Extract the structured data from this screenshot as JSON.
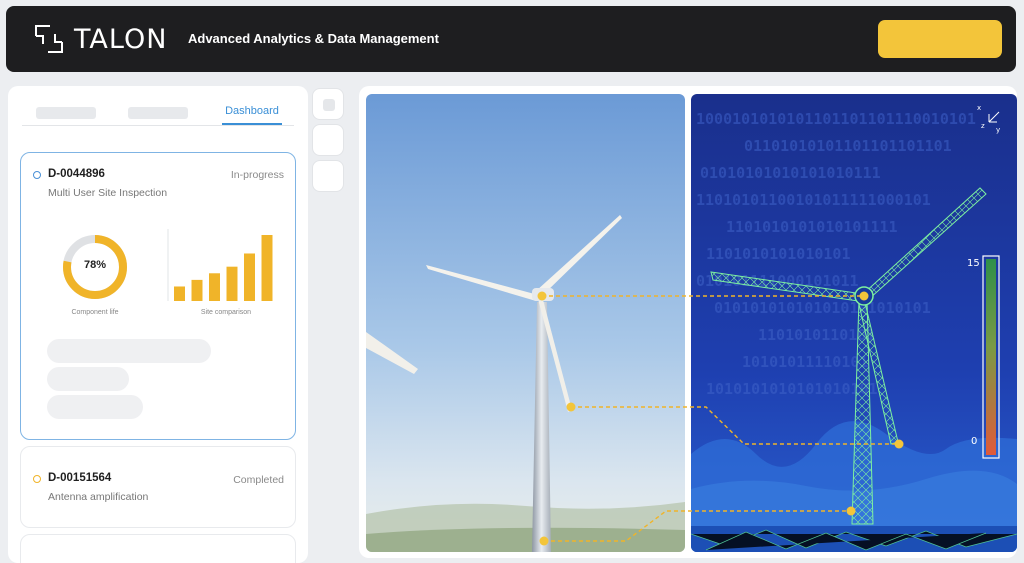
{
  "header": {
    "brand": "TALON",
    "tagline": "Advanced Analytics & Data Management",
    "cta_color": "#f3c53a"
  },
  "tabs": {
    "active_label": "Dashboard"
  },
  "cards": [
    {
      "id": "D-0044896",
      "subtitle": "Multi User Site Inspection",
      "status": "In-progress",
      "dot_color": "#4a90d6"
    },
    {
      "id": "D-00151564",
      "subtitle": "Antenna amplification",
      "status": "Completed",
      "dot_color": "#f0b429"
    }
  ],
  "widgets": {
    "component_life": {
      "value": 0.78,
      "value_text": "78%",
      "label": "Component life"
    },
    "site_comparison": {
      "label": "Site comparison",
      "values": [
        0.22,
        0.32,
        0.42,
        0.52,
        0.72,
        1.0
      ]
    }
  },
  "visualization": {
    "axis_labels": [
      "x",
      "z",
      "y"
    ],
    "scale_max": "15",
    "scale_min": "0",
    "binary_rows": [
      "1000101010101101101101110010101",
      "01101010101101101101101",
      "01010101010101010111",
      "11010101100101011111000101",
      "1101010101010101111",
      "1101010101010101",
      "010101111000101011",
      "010101010101010101010101",
      "1101010110101",
      "10101011110101",
      "1010101010101010101"
    ]
  },
  "colors": {
    "accent_blue": "#3a8fd6",
    "accent_yellow": "#f0b429",
    "heat_top": "#2f8f4a",
    "heat_bottom": "#e05a3a"
  }
}
